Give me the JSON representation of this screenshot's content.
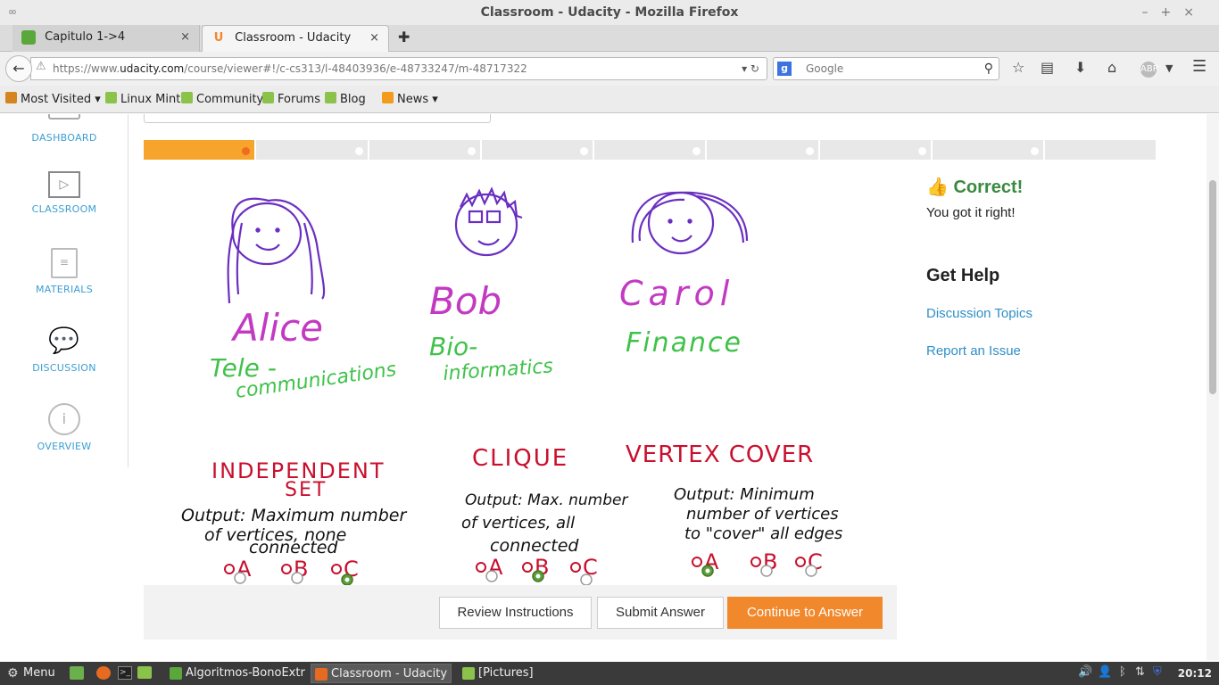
{
  "window": {
    "title": "Classroom - Udacity - Mozilla Firefox"
  },
  "tabs": [
    {
      "label": "Capitulo 1->4"
    },
    {
      "label": "Classroom - Udacity"
    }
  ],
  "nav": {
    "url_prefix": "https://www.",
    "url_domain": "udacity.com",
    "url_path": "/course/viewer#!/c-cs313/l-48403936/e-48733247/m-48717322",
    "search_placeholder": "Google"
  },
  "bookmarks": [
    {
      "label": "Most Visited"
    },
    {
      "label": "Linux Mint"
    },
    {
      "label": "Community"
    },
    {
      "label": "Forums"
    },
    {
      "label": "Blog"
    },
    {
      "label": "News"
    }
  ],
  "sidebar": {
    "items": [
      {
        "label": "DASHBOARD"
      },
      {
        "label": "CLASSROOM"
      },
      {
        "label": "MATERIALS"
      },
      {
        "label": "DISCUSSION"
      },
      {
        "label": "OVERVIEW"
      }
    ]
  },
  "progress": {
    "current_step": 1,
    "total_steps": 9
  },
  "drawing": {
    "people": [
      {
        "name": "Alice",
        "field_line1": "Tele -",
        "field_line2": "communications"
      },
      {
        "name": "Bob",
        "field_line1": "Bio-",
        "field_line2": "informatics"
      },
      {
        "name": "Carol",
        "field_line1": "Finance",
        "field_line2": ""
      }
    ],
    "problems": [
      {
        "title_line1": "INDEPENDENT",
        "title_line2": "SET",
        "desc_line1": "Output: Maximum number",
        "desc_line2": "of vertices, none",
        "desc_line3": "connected",
        "options": [
          "A",
          "B",
          "C"
        ],
        "selected": "C"
      },
      {
        "title_line1": "CLIQUE",
        "title_line2": "",
        "desc_line1": "Output: Max. number",
        "desc_line2": "of vertices, all",
        "desc_line3": "connected",
        "options": [
          "A",
          "B",
          "C"
        ],
        "selected": "B"
      },
      {
        "title_line1": "VERTEX COVER",
        "title_line2": "",
        "desc_line1": "Output: Minimum",
        "desc_line2": "number of vertices",
        "desc_line3": "to \"cover\" all edges",
        "options": [
          "A",
          "B",
          "C"
        ],
        "selected": "A"
      }
    ]
  },
  "feedback": {
    "title": "Correct!",
    "message": "You got it right!"
  },
  "help": {
    "title": "Get Help",
    "links": [
      "Discussion Topics",
      "Report an Issue"
    ]
  },
  "actions": {
    "review": "Review Instructions",
    "submit": "Submit Answer",
    "continue": "Continue to Answer"
  },
  "taskbar": {
    "menu": "Menu",
    "tasks": [
      "Algoritmos-BonoExtr...",
      "Classroom - Udacity -...",
      "[Pictures]"
    ],
    "clock": "20:12"
  },
  "colors": {
    "accent": "#f1882b",
    "link": "#2f8fc7",
    "correct": "#3a8a3f",
    "purple": "#6a2fc0",
    "magenta": "#c23ac2",
    "green": "#3fc24a",
    "red": "#c8102e"
  }
}
